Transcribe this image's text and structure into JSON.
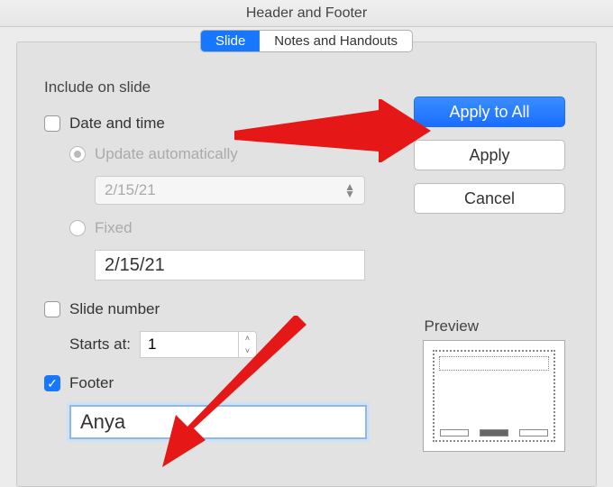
{
  "title": "Header and Footer",
  "tabs": {
    "slide": "Slide",
    "notes": "Notes and Handouts"
  },
  "fieldset": {
    "legend": "Include on slide",
    "date_time": "Date and time",
    "update_auto": "Update automatically",
    "auto_date_value": "2/15/21",
    "fixed": "Fixed",
    "fixed_value": "2/15/21",
    "slide_number": "Slide number",
    "starts_at_label": "Starts at:",
    "starts_at_value": "1",
    "footer_label": "Footer",
    "footer_value": "Anya"
  },
  "buttons": {
    "apply_all": "Apply to All",
    "apply": "Apply",
    "cancel": "Cancel"
  },
  "preview_label": "Preview"
}
